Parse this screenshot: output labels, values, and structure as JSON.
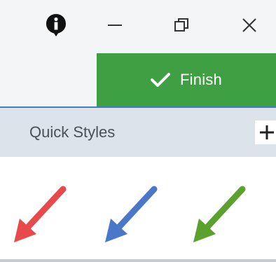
{
  "window": {
    "controls": {
      "info_icon": "info-icon",
      "minimize_icon": "minimize-icon",
      "restore_icon": "restore-icon",
      "close_icon": "close-icon"
    }
  },
  "toolbar": {
    "finish_label": "Finish",
    "finish_icon": "checkmark-icon",
    "finish_color": "#3fa043"
  },
  "quick_styles": {
    "title": "Quick Styles",
    "add_icon": "plus-icon",
    "styles": [
      {
        "name": "red-arrow",
        "color": "#e8494a"
      },
      {
        "name": "blue-arrow",
        "color": "#4a78c9"
      },
      {
        "name": "green-arrow",
        "color": "#5aa12d"
      }
    ]
  }
}
